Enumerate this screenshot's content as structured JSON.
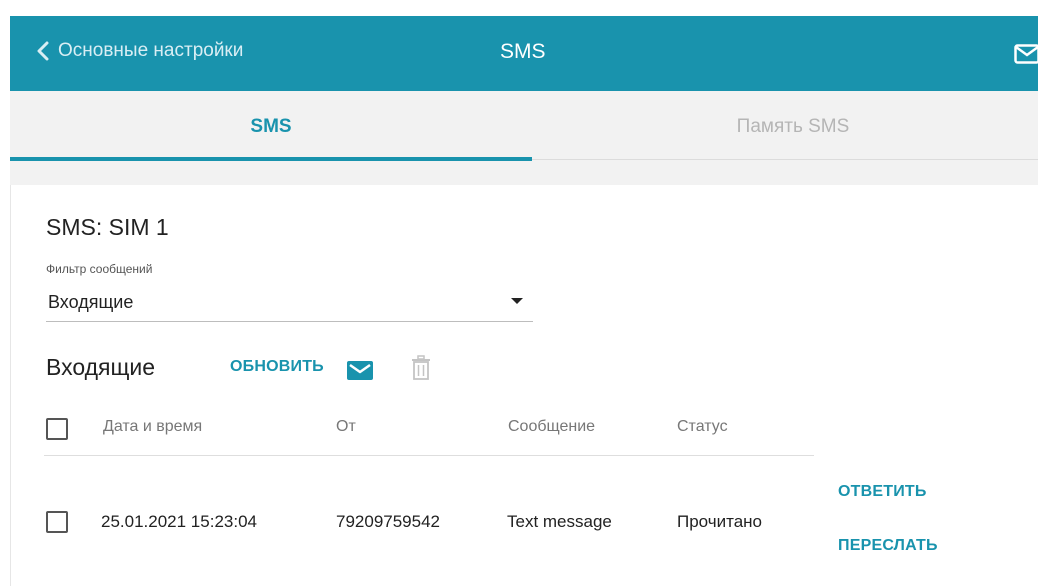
{
  "header": {
    "back_label": "Основные настройки",
    "title": "SMS",
    "back_icon": "chevron-left-icon",
    "mail_icon": "mail-icon"
  },
  "tabs": [
    {
      "label": "SMS",
      "active": true
    },
    {
      "label": "Память SMS",
      "active": false
    }
  ],
  "section": {
    "title": "SMS: SIM 1",
    "filter": {
      "label": "Фильтр сообщений",
      "value": "Входящие"
    }
  },
  "inbox": {
    "title": "Входящие",
    "refresh_label": "ОБНОВИТЬ",
    "columns": [
      "Дата и время",
      "От",
      "Сообщение",
      "Статус"
    ],
    "rows": [
      {
        "date": "25.01.2021 15:23:04",
        "from": "79209759542",
        "message": "Text message",
        "status": "Прочитано",
        "actions": [
          "ОТВЕТИТЬ",
          "ПЕРЕСЛАТЬ"
        ]
      }
    ]
  },
  "colors": {
    "accent": "#1993ad",
    "tab_bg": "#f2f2f2",
    "inactive_tab": "#b5b5b5"
  }
}
